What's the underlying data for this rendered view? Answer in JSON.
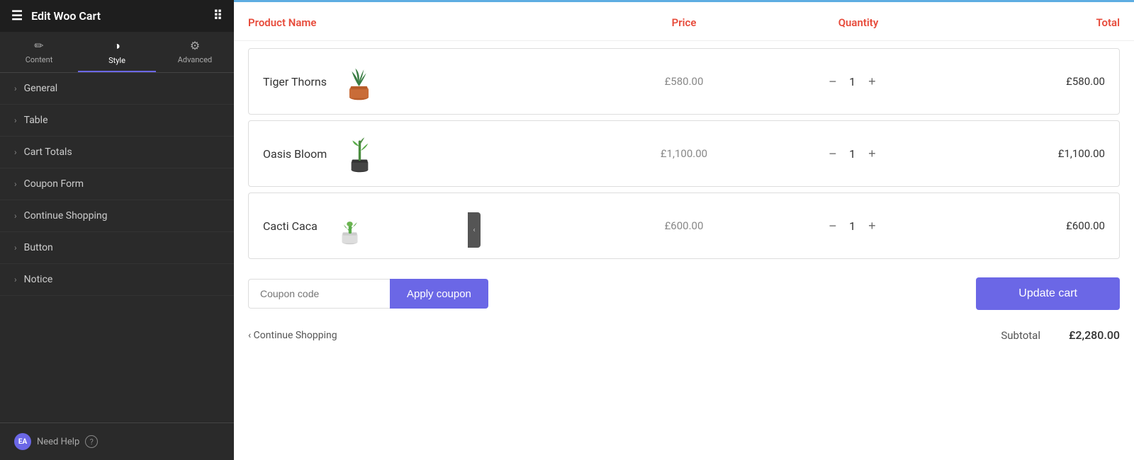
{
  "sidebar": {
    "title": "Edit Woo Cart",
    "tabs": [
      {
        "id": "content",
        "label": "Content",
        "icon": "✏️"
      },
      {
        "id": "style",
        "label": "Style",
        "icon": "🎨",
        "active": true
      },
      {
        "id": "advanced",
        "label": "Advanced",
        "icon": "⚙️"
      }
    ],
    "nav_items": [
      {
        "label": "General"
      },
      {
        "label": "Table"
      },
      {
        "label": "Cart Totals"
      },
      {
        "label": "Coupon Form"
      },
      {
        "label": "Continue Shopping"
      },
      {
        "label": "Button"
      },
      {
        "label": "Notice"
      }
    ],
    "footer": {
      "badge": "EA",
      "label": "Need Help",
      "help": "?"
    }
  },
  "cart": {
    "columns": {
      "product_name": "Product Name",
      "price": "Price",
      "quantity": "Quantity",
      "total": "Total"
    },
    "rows": [
      {
        "name": "Tiger Thorns",
        "price": "£580.00",
        "qty": 1,
        "total": "£580.00",
        "plant_type": "orange_pot"
      },
      {
        "name": "Oasis Bloom",
        "price": "£1,100.00",
        "qty": 1,
        "total": "£1,100.00",
        "plant_type": "dark_pot"
      },
      {
        "name": "Cacti Caca",
        "price": "£600.00",
        "qty": 1,
        "total": "£600.00",
        "plant_type": "white_pot"
      }
    ],
    "coupon_placeholder": "Coupon code",
    "apply_coupon_label": "Apply coupon",
    "update_cart_label": "Update cart",
    "continue_shopping_label": "‹ Continue Shopping",
    "subtotal_label": "Subtotal",
    "subtotal_value": "£2,280.00"
  }
}
